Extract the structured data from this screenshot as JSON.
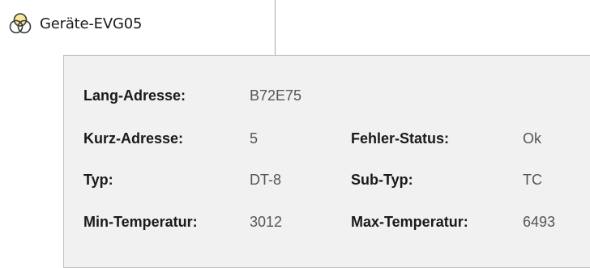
{
  "tree": {
    "device_label": "Geräte-EVG05",
    "icon": "device-group-icon"
  },
  "tooltip": {
    "rows": [
      {
        "label": "Lang-Adresse:",
        "value": "B72E75"
      },
      {
        "label": "Kurz-Adresse:",
        "value": "5",
        "label2": "Fehler-Status:",
        "value2": "Ok"
      },
      {
        "label": "Typ:",
        "value": "DT-8",
        "label2": "Sub-Typ:",
        "value2": "TC"
      },
      {
        "label": "Min-Temperatur:",
        "value": "3012",
        "label2": "Max-Temperatur:",
        "value2": "6493"
      }
    ]
  },
  "colors": {
    "icon_circle_yellow": "#f2c200",
    "icon_outline": "#3a3a3a",
    "tooltip_background": "#f1f1f1",
    "tooltip_border": "#c4c4c4",
    "value_text": "#555555"
  }
}
